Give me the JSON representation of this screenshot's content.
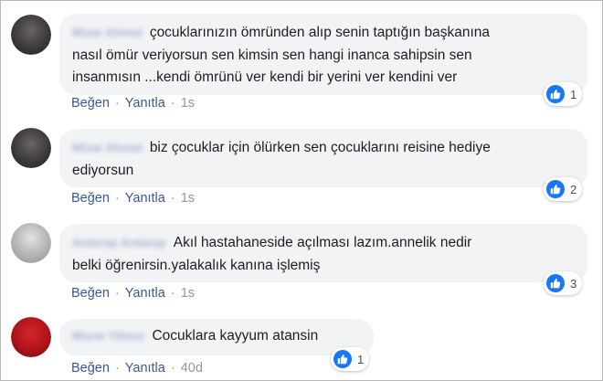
{
  "comments": [
    {
      "author": "Mizar Ahmet",
      "text_lines": [
        "çocuklarınızın ömründen alıp senin taptığın başkanına",
        "nasıl ömür veriyorsun sen kimsin sen hangi inanca sahipsin sen",
        "insanmısın ...kendi ömrünü ver kendi bir yerini ver kendini ver"
      ],
      "like_label": "Beğen",
      "reply_label": "Yanıtla",
      "time": "1s",
      "reaction_count": "1",
      "avatar_color": "#3b3a3c"
    },
    {
      "author": "Mizar Ahmet",
      "text_lines": [
        "biz çocuklar için ölürken sen çocuklarını reisine hediye",
        "ediyorsun"
      ],
      "like_label": "Beğen",
      "reply_label": "Yanıtla",
      "time": "1s",
      "reaction_count": "2",
      "avatar_color": "#3b3a3c"
    },
    {
      "author": "Antürap Antürap",
      "text_lines": [
        "Akıl hastahaneside açılması lazım.annelik nedir",
        "belki öğrenirsin.yalakalık kanına işlemiş"
      ],
      "like_label": "Beğen",
      "reply_label": "Yanıtla",
      "time": "1s",
      "reaction_count": "3",
      "avatar_color": "#a7a9ab"
    },
    {
      "author": "Murat Yilmaz",
      "text_lines": [
        "Cocuklara kayyum atansin"
      ],
      "like_label": "Beğen",
      "reply_label": "Yanıtla",
      "time": "40d",
      "reaction_count": "1",
      "avatar_color": "#b3151a"
    }
  ],
  "colors": {
    "link": "#385898",
    "bubble": "#f2f3f5",
    "like_blue": "#1877f2",
    "muted": "#90949c"
  },
  "icons": {
    "reaction": "like-thumb-icon",
    "separator": "middle-dot"
  },
  "separator_char": "·"
}
